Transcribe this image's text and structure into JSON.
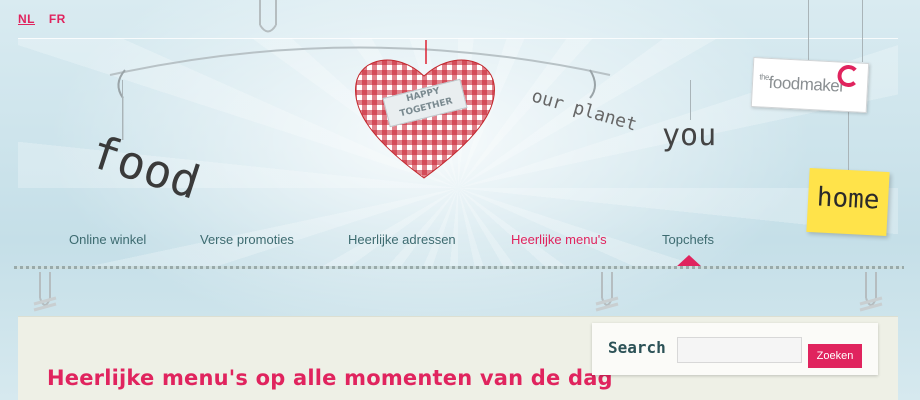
{
  "lang": {
    "nl": "NL",
    "fr": "FR"
  },
  "header": {
    "words": {
      "food": "food",
      "planet": "our planet",
      "you": "you"
    },
    "heart_tag": "HAPPY TOGETHER",
    "logo": {
      "the": "the",
      "name": "foodmaker"
    },
    "home_label": "home"
  },
  "nav": {
    "items": [
      "Online winkel",
      "Verse promoties",
      "Heerlijke adressen",
      "Heerlijke menu's",
      "Topchefs"
    ],
    "active_index": 3
  },
  "search": {
    "label": "Search",
    "value": "",
    "button": "Zoeken"
  },
  "main": {
    "title": "Heerlijke menu's op alle momenten van de dag"
  },
  "colors": {
    "accent": "#e0245e",
    "nav_text": "#3d6b70",
    "note": "#ffe34a"
  }
}
